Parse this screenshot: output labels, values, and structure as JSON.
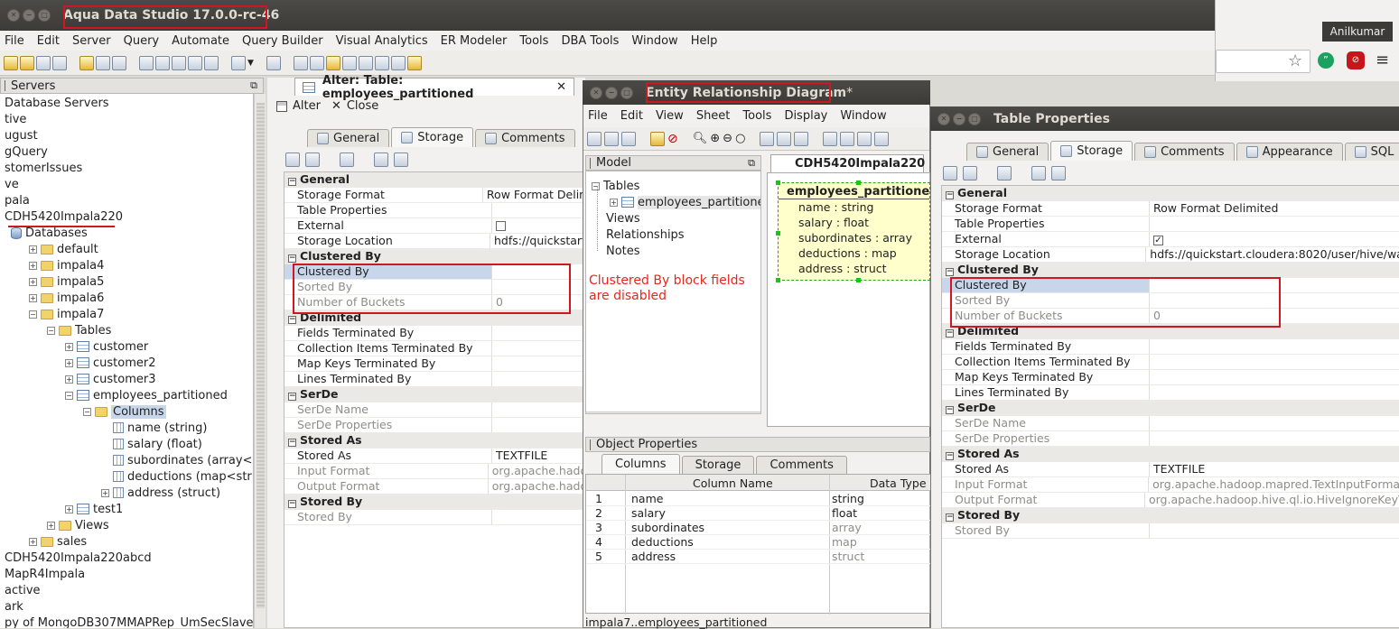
{
  "main_window": {
    "title": "Aqua Data Studio 17.0.0-rc-46",
    "menu": [
      "File",
      "Edit",
      "Server",
      "Query",
      "Automate",
      "Query Builder",
      "Visual Analytics",
      "ER Modeler",
      "Tools",
      "DBA Tools",
      "Window",
      "Help"
    ],
    "user": "Anilkumar"
  },
  "servers_panel": {
    "title": "Servers",
    "items": [
      {
        "label": "Database Servers",
        "indent": 0,
        "icon": "none"
      },
      {
        "label": "tive",
        "indent": 0,
        "icon": "none"
      },
      {
        "label": "ugust",
        "indent": 0,
        "icon": "none"
      },
      {
        "label": "gQuery",
        "indent": 0,
        "icon": "none"
      },
      {
        "label": "stomerIssues",
        "indent": 0,
        "icon": "none"
      },
      {
        "label": "ve",
        "indent": 0,
        "icon": "none"
      },
      {
        "label": "pala",
        "indent": 0,
        "icon": "none"
      },
      {
        "label": "CDH5420Impala220",
        "indent": 0,
        "icon": "none"
      },
      {
        "label": "Databases",
        "indent": 1,
        "icon": "db"
      },
      {
        "label": "default",
        "indent": 2,
        "icon": "fold",
        "toggle": "+"
      },
      {
        "label": "impala4",
        "indent": 2,
        "icon": "fold",
        "toggle": "+"
      },
      {
        "label": "impala5",
        "indent": 2,
        "icon": "fold",
        "toggle": "+"
      },
      {
        "label": "impala6",
        "indent": 2,
        "icon": "fold",
        "toggle": "+"
      },
      {
        "label": "impala7",
        "indent": 2,
        "icon": "fold",
        "toggle": "−"
      },
      {
        "label": "Tables",
        "indent": 3,
        "icon": "fold",
        "toggle": "−"
      },
      {
        "label": "customer",
        "indent": 4,
        "icon": "tbl",
        "toggle": "+"
      },
      {
        "label": "customer2",
        "indent": 4,
        "icon": "tbl",
        "toggle": "+"
      },
      {
        "label": "customer3",
        "indent": 4,
        "icon": "tbl",
        "toggle": "+"
      },
      {
        "label": "employees_partitioned",
        "indent": 4,
        "icon": "tbl",
        "toggle": "−"
      },
      {
        "label": "Columns",
        "indent": 5,
        "icon": "fold",
        "toggle": "−",
        "selected": true
      },
      {
        "label": "name (string)",
        "indent": 6,
        "icon": "col"
      },
      {
        "label": "salary (float)",
        "indent": 6,
        "icon": "col"
      },
      {
        "label": "subordinates (array<str",
        "indent": 6,
        "icon": "col"
      },
      {
        "label": "deductions (map<string",
        "indent": 6,
        "icon": "col"
      },
      {
        "label": "address (struct)",
        "indent": 6,
        "icon": "col",
        "toggle": "+"
      },
      {
        "label": "test1",
        "indent": 4,
        "icon": "tbl",
        "toggle": "+"
      },
      {
        "label": "Views",
        "indent": 3,
        "icon": "fold",
        "toggle": "+"
      },
      {
        "label": "sales",
        "indent": 2,
        "icon": "fold",
        "toggle": "+"
      },
      {
        "label": "CDH5420Impala220abcd",
        "indent": 0,
        "icon": "none"
      },
      {
        "label": "MapR4Impala",
        "indent": 0,
        "icon": "none"
      },
      {
        "label": "active",
        "indent": 0,
        "icon": "none"
      },
      {
        "label": "ark",
        "indent": 0,
        "icon": "none"
      },
      {
        "label": "py of MongoDB307MMAPRep_UmSecSlave",
        "indent": 0,
        "icon": "none"
      }
    ]
  },
  "alter_tab": {
    "title": "Alter: Table: employees_partitioned",
    "alter_label": "Alter",
    "close_label": "Close",
    "tabs": [
      "General",
      "Storage",
      "Comments"
    ],
    "active_tab": "Storage"
  },
  "properties": [
    {
      "k": "General",
      "type": "section"
    },
    {
      "k": "Storage Format",
      "v": "Row Format Delimited"
    },
    {
      "k": "Table Properties",
      "v": ""
    },
    {
      "k": "External",
      "v": "",
      "checkbox": false
    },
    {
      "k": "Storage Location",
      "v": "hdfs://quickstart.cloudera:8020/user/hive/wa"
    },
    {
      "k": "Clustered By",
      "type": "section"
    },
    {
      "k": "Clustered By",
      "v": "",
      "selected": true
    },
    {
      "k": "Sorted By",
      "v": "",
      "disabled": true
    },
    {
      "k": "Number of Buckets",
      "v": "0",
      "disabled": true
    },
    {
      "k": "Delimited",
      "type": "section"
    },
    {
      "k": "Fields Terminated By",
      "v": ""
    },
    {
      "k": "Collection Items Terminated By",
      "v": ""
    },
    {
      "k": "Map Keys Terminated By",
      "v": ""
    },
    {
      "k": "Lines Terminated By",
      "v": ""
    },
    {
      "k": "SerDe",
      "type": "section"
    },
    {
      "k": "SerDe Name",
      "v": "",
      "disabled": true
    },
    {
      "k": "SerDe Properties",
      "v": "",
      "disabled": true
    },
    {
      "k": "Stored As",
      "type": "section"
    },
    {
      "k": "Stored As",
      "v": "TEXTFILE"
    },
    {
      "k": "Input Format",
      "v": "org.apache.hadoop.mapred.TextInputForma",
      "disabled": true
    },
    {
      "k": "Output Format",
      "v": "org.apache.hadoop.hive.ql.io.HiveIgnoreKeyT",
      "disabled": true
    },
    {
      "k": "Stored By",
      "type": "section"
    },
    {
      "k": "Stored By",
      "v": "",
      "disabled": true
    }
  ],
  "alter_values_short": {
    "storage_format": "Row Format Delim",
    "storage_location": "hdfs://quickstart",
    "input_format": "org.apache.hado",
    "output_format": "org.apache.hado"
  },
  "erd_window": {
    "title": "Entity Relationship Diagram",
    "title_suffix": " *",
    "menu": [
      "File",
      "Edit",
      "View",
      "Sheet",
      "Tools",
      "Display",
      "Window"
    ],
    "model_title": "Model",
    "model_tree": [
      "Tables",
      "employees_partitioned",
      "Views",
      "Relationships",
      "Notes"
    ],
    "annotation": "Clustered By block fields are disabled",
    "diagram_tab": "CDH5420Impala220",
    "entity_title": "employees_partitioned",
    "entity_fields": [
      "name : string",
      "salary : float",
      "subordinates : array",
      "deductions : map",
      "address : struct"
    ],
    "object_props_title": "Object Properties",
    "object_tabs": [
      "Columns",
      "Storage",
      "Comments"
    ],
    "grid_headers": [
      "Column Name",
      "Data Type"
    ],
    "grid_rows": [
      {
        "n": "1",
        "name": "name",
        "type": "string"
      },
      {
        "n": "2",
        "name": "salary",
        "type": "float"
      },
      {
        "n": "3",
        "name": "subordinates",
        "type": "array"
      },
      {
        "n": "4",
        "name": "deductions",
        "type": "map"
      },
      {
        "n": "5",
        "name": "address",
        "type": "struct"
      }
    ],
    "status": "impala7..employees_partitioned"
  },
  "table_props_window": {
    "title": "Table Properties",
    "tabs": [
      "General",
      "Storage",
      "Comments",
      "Appearance",
      "SQL"
    ],
    "active_tab": "Storage"
  }
}
